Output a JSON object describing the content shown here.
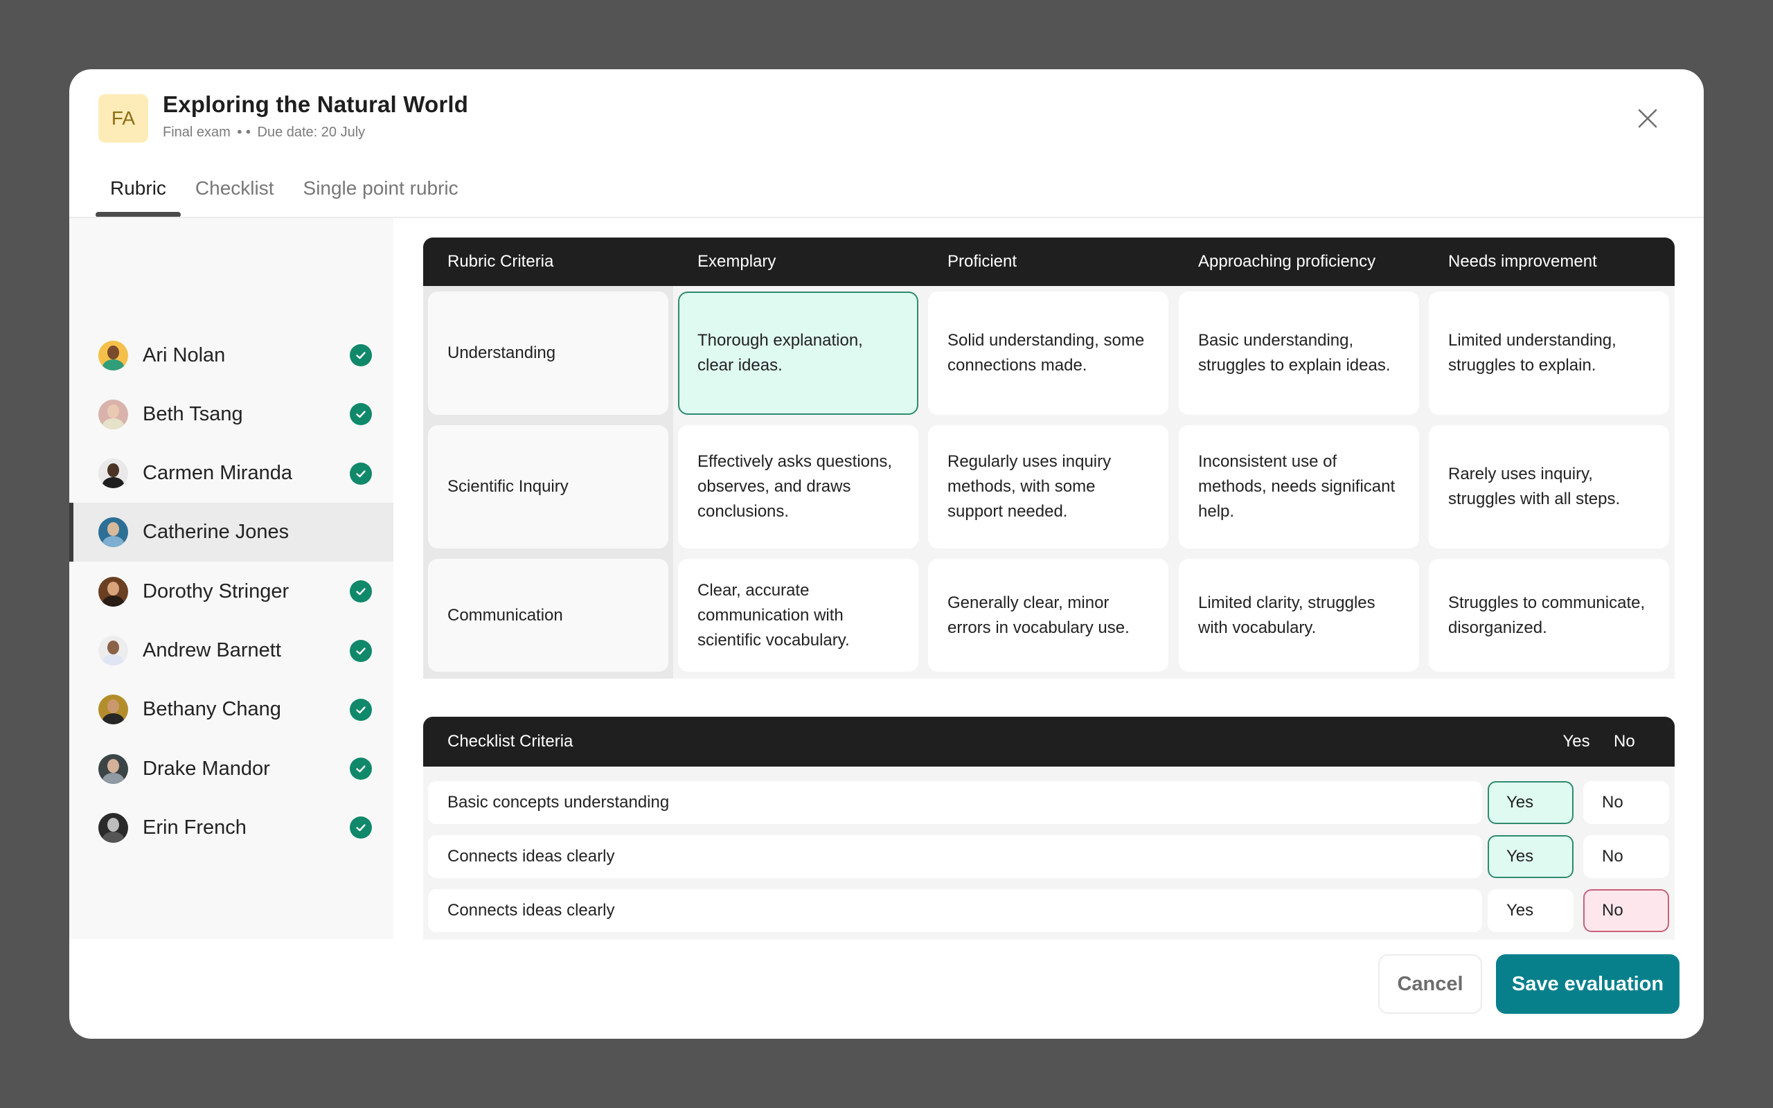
{
  "header": {
    "badge": "FA",
    "title": "Exploring the Natural World",
    "subtitle_type": "Final exam",
    "subtitle_sep": "• •",
    "subtitle_due": "Due date: 20 July",
    "close_icon": "close-icon"
  },
  "tabs": [
    {
      "label": "Rubric",
      "active": true
    },
    {
      "label": "Checklist",
      "active": false
    },
    {
      "label": "Single point rubric",
      "active": false
    }
  ],
  "students": [
    {
      "name": "Ari Nolan",
      "done": true,
      "avatar_bg": "#f5c04a",
      "skin": "#7a4a2c",
      "shirt": "#2f9e79"
    },
    {
      "name": "Beth Tsang",
      "done": true,
      "avatar_bg": "#d9b3ab",
      "skin": "#e9c9b2",
      "shirt": "#e6e1c9"
    },
    {
      "name": "Carmen Miranda",
      "done": true,
      "avatar_bg": "#e9e9e9",
      "skin": "#4b3326",
      "shirt": "#1f1f1f"
    },
    {
      "name": "Catherine Jones",
      "done": false,
      "active": true,
      "avatar_bg": "#2e6f96",
      "skin": "#d8b99a",
      "shirt": "#7eaed0"
    },
    {
      "name": "Dorothy Stringer",
      "done": true,
      "avatar_bg": "#6b3f22",
      "skin": "#d8a47b",
      "shirt": "#2a1d16"
    },
    {
      "name": "Andrew Barnett",
      "done": true,
      "avatar_bg": "#ededed",
      "skin": "#8a6248",
      "shirt": "#dfe5f3"
    },
    {
      "name": "Bethany Chang",
      "done": true,
      "avatar_bg": "#b38d2b",
      "skin": "#c9996d",
      "shirt": "#262626"
    },
    {
      "name": "Drake Mandor",
      "done": true,
      "avatar_bg": "#3c4546",
      "skin": "#d4b199",
      "shirt": "#8f9aa3"
    },
    {
      "name": "Erin French",
      "done": true,
      "avatar_bg": "#2a2a2a",
      "skin": "#bdbdbd",
      "shirt": "#555555"
    }
  ],
  "rubric": {
    "headers": [
      "Rubric Criteria",
      "Exemplary",
      "Proficient",
      "Approaching proficiency",
      "Needs improvement"
    ],
    "rows": [
      {
        "criterion": "Understanding",
        "levels": [
          "Thorough explanation, clear ideas.",
          "Solid understanding, some connections made.",
          "Basic understanding, struggles to explain ideas.",
          "Limited understanding, struggles to explain."
        ],
        "selected": 0
      },
      {
        "criterion": "Scientific Inquiry",
        "levels": [
          "Effectively asks questions, observes, and draws conclusions.",
          "Regularly uses inquiry methods, with some support needed.",
          "Inconsistent use of methods, needs significant help.",
          "Rarely uses inquiry, struggles with all steps."
        ],
        "selected": null
      },
      {
        "criterion": "Communication",
        "levels": [
          "Clear, accurate communication with scientific vocabulary.",
          "Generally clear, minor errors in vocabulary use.",
          "Limited clarity, struggles with vocabulary.",
          "Struggles to communicate, disorganized."
        ],
        "selected": null
      }
    ]
  },
  "checklist": {
    "headers": {
      "criteria": "Checklist Criteria",
      "yes": "Yes",
      "no": "No"
    },
    "rows": [
      {
        "label": "Basic concepts understanding",
        "yes": "Yes",
        "no": "No",
        "value": "yes"
      },
      {
        "label": "Connects ideas clearly",
        "yes": "Yes",
        "no": "No",
        "value": "yes"
      },
      {
        "label": "Connects ideas clearly",
        "yes": "Yes",
        "no": "No",
        "value": "no"
      }
    ]
  },
  "footer": {
    "cancel_label": "Cancel",
    "save_label": "Save evaluation"
  },
  "colors": {
    "accent": "#07808c",
    "check_badge": "#10886a",
    "selected_fill": "#dffaf1",
    "selected_border": "#2f8a6e",
    "no_fill": "#fde7ec",
    "no_border": "#c9607a"
  }
}
